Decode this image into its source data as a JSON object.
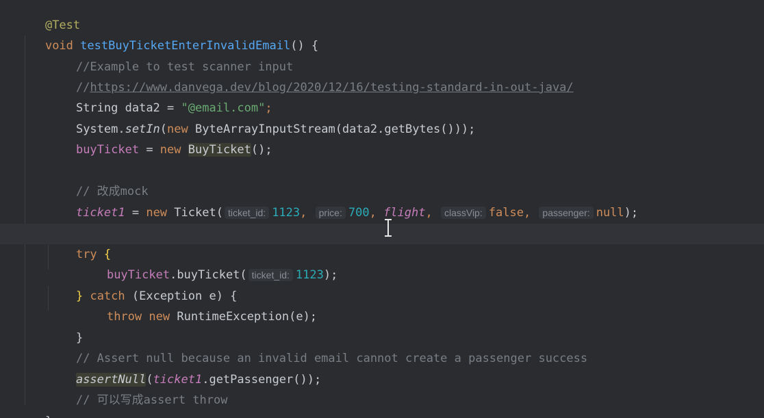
{
  "code": {
    "annotation": "@Test",
    "method_signature": {
      "kw_void": "void",
      "name": "testBuyTicketEnterInvalidEmail",
      "rest": "() {"
    },
    "comment1": "//Example to test scanner input",
    "comment2_prefix": "//",
    "comment2_url": "https://www.danvega.dev/blog/2020/12/16/testing-standard-in-out-java/",
    "line_string": {
      "type": "String",
      "var": " data2 = ",
      "value": "\"@email.com\"",
      "end": ";"
    },
    "line_setin": {
      "obj": "System.",
      "method": "setIn",
      "open": "(",
      "kw_new": "new",
      "rest": " ByteArrayInputStream(data2.getBytes()));"
    },
    "line_buy": {
      "field": "buyTicket",
      "eq": " = ",
      "kw_new": "new",
      "cls": "BuyTicket",
      "end": "();"
    },
    "comment_mock": "// 改成mock",
    "line_ticket": {
      "field": "ticket1",
      "eq": " = ",
      "kw_new": "new",
      "cls": " Ticket(",
      "hint_id": "ticket_id:",
      "val_id": "1123",
      "hint_price": "price:",
      "val_price": "700",
      "flight": "flight",
      "hint_vip": "classVip:",
      "val_vip": "false",
      "hint_passenger": "passenger:",
      "val_passenger": "null",
      "end": ");"
    },
    "kw_try": "try",
    "brace_open": "{",
    "line_call": {
      "field": "buyTicket",
      "rest": ".buyTicket(",
      "hint_id": "ticket_id:",
      "val": "1123",
      "end": ");"
    },
    "catch_brace": "}",
    "kw_catch": "catch",
    "catch_rest": " (Exception e) {",
    "kw_throw": "throw",
    "kw_new2": "new",
    "throw_rest": " RuntimeException(e);",
    "close_brace": "}",
    "comment_assert": "// Assert null because an invalid email cannot create a passenger success",
    "assert_line": {
      "method": "assertNull",
      "open": "(",
      "field": "ticket1",
      "rest": ".getPassenger());"
    },
    "comment_throw": "// 可以写成assert throw",
    "final_brace": "}"
  },
  "colors": {
    "background": "#2a2c2f",
    "keyword": "#d08d5a",
    "string": "#6aab73",
    "number": "#2aacb8",
    "comment": "#7a7e85",
    "function": "#56a8f5",
    "field": "#c77dbb"
  }
}
